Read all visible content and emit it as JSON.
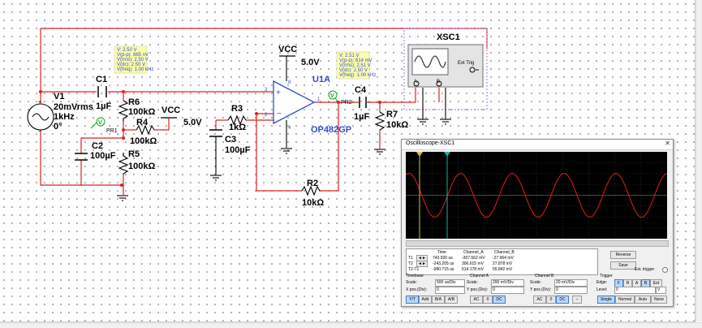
{
  "schematic": {
    "source": {
      "name": "V1",
      "amplitude": "20mVrms",
      "frequency": "1kHz",
      "phase": "0°"
    },
    "c1": {
      "name": "C1",
      "value": "1µF"
    },
    "r6": {
      "name": "R6",
      "value": "100kΩ"
    },
    "r4": {
      "name": "R4",
      "value": "100kΩ"
    },
    "r5": {
      "name": "R5",
      "value": "100kΩ"
    },
    "c2": {
      "name": "C2",
      "value": "100µF"
    },
    "vcc_left": {
      "label": "VCC",
      "value": "5.0V"
    },
    "r3": {
      "name": "R3",
      "value": "1kΩ"
    },
    "c3": {
      "name": "C3",
      "value": "100µF"
    },
    "vcc_top": {
      "label": "VCC",
      "value": "5.0V"
    },
    "opamp": {
      "name": "U1A",
      "part": "OP482GP",
      "pin_in_plus": "3",
      "pin_in_minus": "2",
      "pin_out": "1",
      "pin_top": "8",
      "pin_bottom": "4"
    },
    "r2": {
      "name": "R2",
      "value": "10kΩ"
    },
    "c4": {
      "name": "C4",
      "value": "1µF"
    },
    "r7": {
      "name": "R7",
      "value": "10kΩ"
    },
    "probe1": {
      "name": "PR1",
      "readout": [
        "V: 2.50 V",
        "V(p-p): 865 nV",
        "V(rms): 2.50 V",
        "V(dc): 2.50 V",
        "V(freq): 1.00 kHz"
      ]
    },
    "probe2": {
      "name": "PR2",
      "readout": [
        "V: 2.51 V",
        "V(p-p): 614 mV",
        "V(rms): 2.51 V",
        "V(dc): 2.50 V",
        "V(freq): 1.00 kHz"
      ]
    },
    "scope_instrument": {
      "name": "XSC1",
      "ext_trig": "Ext Trig",
      "ch_a": "A",
      "ch_b": "B"
    }
  },
  "oscilloscope": {
    "title": "Oscilloscope-XSC1",
    "close": "✕",
    "cursors": [
      {
        "name": "T1",
        "color": "#d8c23a"
      },
      {
        "name": "T2",
        "color": "#19b2a4"
      }
    ],
    "trace_color": "#d41a1a",
    "measurements": {
      "headers": [
        "Time",
        "Channel_A",
        "Channel_B"
      ],
      "rows": [
        {
          "label": "T1",
          "time": "743.920 us",
          "a": "-307.562 mV",
          "b": "-27.964 mV"
        },
        {
          "label": "T2",
          "time": "-243.205 us",
          "a": "306.615 mV",
          "b": "27.878 mV"
        },
        {
          "label": "T2-T1",
          "time": "-980.715 us",
          "a": "614.178 mV",
          "b": "55.842 mV"
        }
      ]
    },
    "buttons": {
      "reverse": "Reverse",
      "save": "Save",
      "ext_trigger": "Ext. trigger"
    },
    "timebase": {
      "title": "Timebase",
      "scale_label": "Scale:",
      "scale": "500 us/Div",
      "xpos_label": "X pos.(Div):",
      "xpos": "0",
      "modes": [
        "Y/T",
        "Add",
        "B/A",
        "A/B"
      ],
      "active": "Y/T"
    },
    "channel_a": {
      "title": "Channel A",
      "scale_label": "Scale:",
      "scale": "200 mV/Div",
      "ypos_label": "Y pos.(Div):",
      "ypos": "0",
      "coupling": [
        "AC",
        "0",
        "DC"
      ],
      "active": "DC"
    },
    "channel_b": {
      "title": "Channel B",
      "scale_label": "Scale:",
      "scale": "20 mV/Div",
      "ypos_label": "Y pos.(Div):",
      "ypos": "0",
      "coupling": [
        "AC",
        "0",
        "DC"
      ],
      "active": "DC"
    },
    "trigger": {
      "title": "Trigger",
      "edge_label": "Edge:",
      "edges": [
        "F",
        "R",
        "A",
        "B",
        "Ext"
      ],
      "level_label": "Level:",
      "level": "0",
      "level_unit": "V",
      "modes": [
        "Single",
        "Normal",
        "Auto",
        "None"
      ],
      "active_mode": "Single"
    }
  }
}
